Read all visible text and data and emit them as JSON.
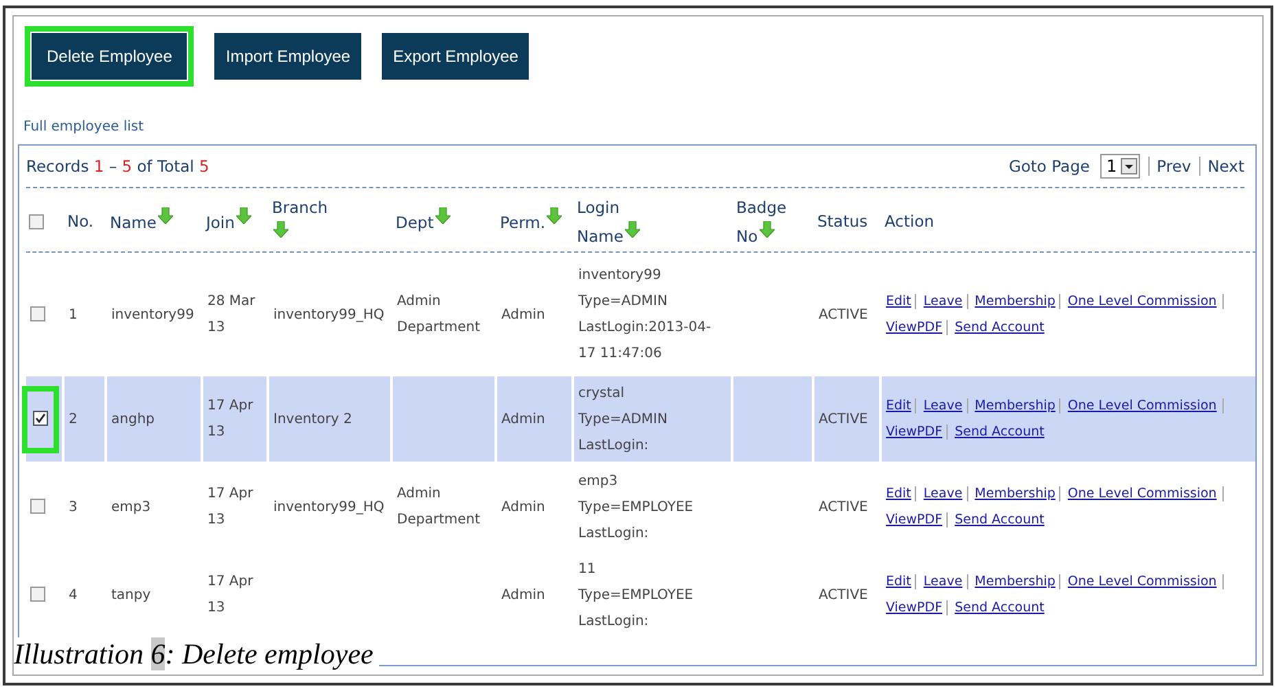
{
  "toolbar": {
    "buttons": [
      {
        "label": "Delete Employee",
        "highlighted": true
      },
      {
        "label": "Import Employee",
        "highlighted": false
      },
      {
        "label": "Export Employee",
        "highlighted": false
      }
    ]
  },
  "list_link": "Full employee list",
  "records": {
    "label": "Records",
    "from": "1",
    "dash": "–",
    "to": "5",
    "of": "of Total",
    "total": "5"
  },
  "pager": {
    "label": "Goto Page",
    "page": "1",
    "prev": "Prev",
    "next": "Next"
  },
  "table": {
    "select_all": {
      "checked": false
    },
    "columns": [
      {
        "kind": "checkbox"
      },
      {
        "label": "No.",
        "kind": "text",
        "sortable": false
      },
      {
        "label": "Name",
        "kind": "text",
        "sortable": true
      },
      {
        "label": "Join",
        "kind": "text",
        "sortable": true
      },
      {
        "label": "Branch",
        "kind": "text",
        "sortable": true
      },
      {
        "label": "Dept",
        "kind": "text",
        "sortable": true
      },
      {
        "label": "Perm.",
        "kind": "text",
        "sortable": true
      },
      {
        "label": "Login Name",
        "kind": "text",
        "sortable": true
      },
      {
        "label": "Badge No",
        "kind": "text",
        "sortable": true
      },
      {
        "label": "Status",
        "kind": "text",
        "sortable": false
      },
      {
        "label": "Action",
        "kind": "text",
        "sortable": false
      }
    ],
    "rows": [
      {
        "checked": false,
        "highlighted": false,
        "no": "1",
        "name": "inventory99",
        "join": "28 Mar 13",
        "branch": "inventory99_HQ",
        "dept": "Admin Department",
        "perm": "Admin",
        "login": [
          "inventory99",
          "Type=ADMIN",
          "LastLogin:2013-04-17 11:47:06"
        ],
        "status": "ACTIVE",
        "actions": [
          "Edit",
          "Leave",
          "Membership",
          "One Level Commission",
          "ViewPDF",
          "Send Account"
        ]
      },
      {
        "checked": true,
        "highlighted": true,
        "no": "2",
        "name": "anghp",
        "join": "17 Apr 13",
        "branch": "Inventory 2",
        "perm": "Admin",
        "login": [
          "crystal",
          "Type=ADMIN",
          "LastLogin:"
        ],
        "status": "ACTIVE",
        "actions": [
          "Edit",
          "Leave",
          "Membership",
          "One Level Commission",
          "ViewPDF",
          "Send Account"
        ]
      },
      {
        "checked": false,
        "highlighted": false,
        "no": "3",
        "name": "emp3",
        "join": "17 Apr 13",
        "branch": "inventory99_HQ",
        "dept": "Admin Department",
        "perm": "Admin",
        "login": [
          "emp3",
          "Type=EMPLOYEE",
          "LastLogin:"
        ],
        "status": "ACTIVE",
        "actions": [
          "Edit",
          "Leave",
          "Membership",
          "One Level Commission",
          "ViewPDF",
          "Send Account"
        ]
      },
      {
        "checked": false,
        "highlighted": false,
        "no": "4",
        "name": "tanpy",
        "join": "17 Apr 13",
        "perm": "Admin",
        "login": [
          "11",
          "Type=EMPLOYEE",
          "LastLogin:"
        ],
        "status": "ACTIVE",
        "actions": [
          "Edit",
          "Leave",
          "Membership",
          "One Level Commission",
          "ViewPDF",
          "Send Account"
        ]
      }
    ]
  },
  "caption": {
    "label": "Illustration",
    "number": "6",
    "text": ": Delete employee"
  }
}
